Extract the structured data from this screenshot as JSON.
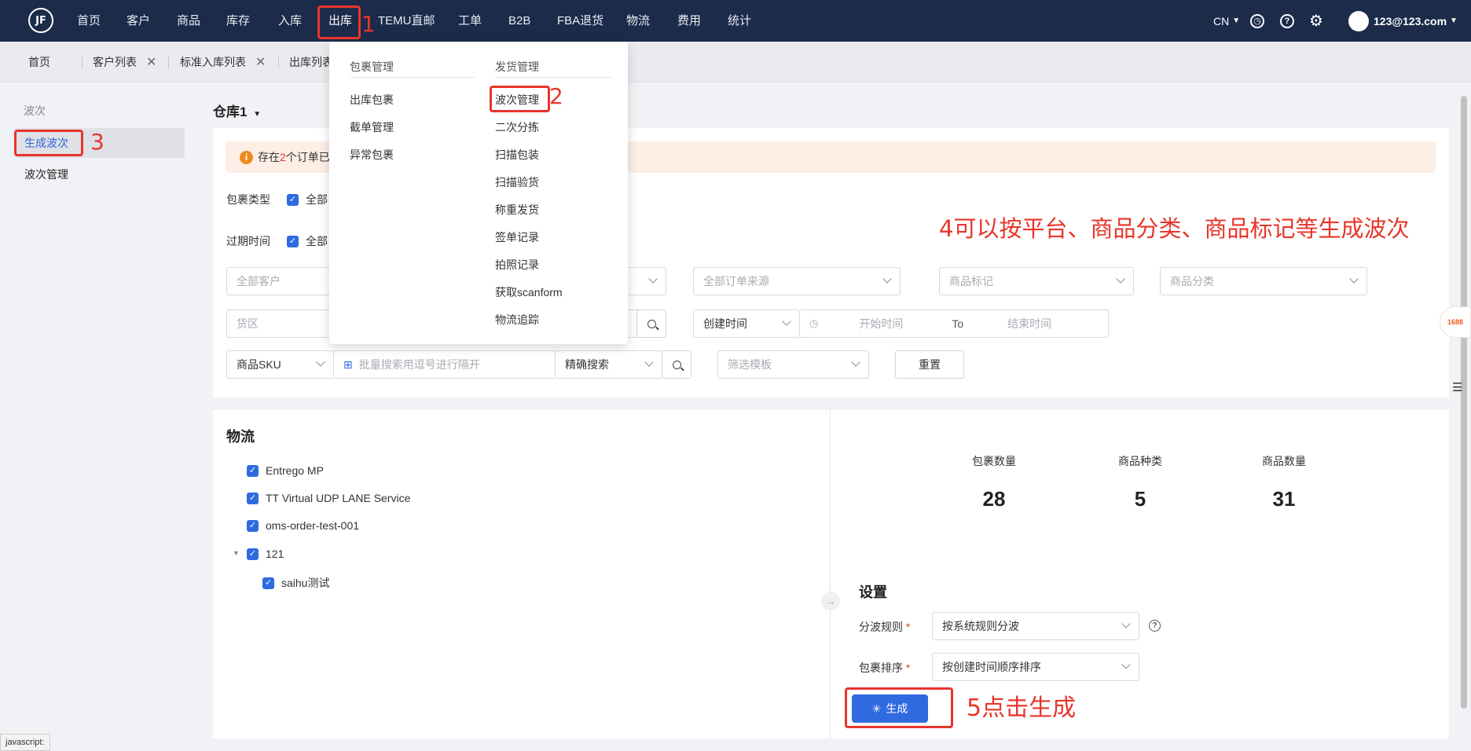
{
  "nav": {
    "logo": "JF",
    "items": [
      "首页",
      "客户",
      "商品",
      "库存",
      "入库",
      "出库",
      "TEMU直邮",
      "工单",
      "B2B",
      "FBA退货",
      "物流",
      "费用",
      "统计"
    ],
    "lang": "CN",
    "user": "123@123.com"
  },
  "tabs": [
    "首页",
    "客户列表",
    "标准入库列表",
    "出库列表"
  ],
  "sidebar": {
    "group": "波次",
    "items": [
      "生成波次",
      "波次管理"
    ]
  },
  "main": {
    "warehouse": "仓库1",
    "alert_pre": "存在",
    "alert_num": "2",
    "alert_post": "个订单已",
    "filters": {
      "package_type_label": "包裹类型",
      "package_type_value": "全部",
      "expire_label": "过期时间",
      "expire_value": "全部",
      "customer_placeholder": "全部客户",
      "order_source_placeholder": "全部订单来源",
      "product_tag_placeholder": "商品标记",
      "product_category_placeholder": "商品分类",
      "area_placeholder": "货区",
      "time_type": "创建时间",
      "start_placeholder": "开始时间",
      "to": "To",
      "end_placeholder": "结束时间",
      "sku_type": "商品SKU",
      "batch_search_placeholder": "批量搜索用逗号进行隔开",
      "search_mode": "精确搜索",
      "template_placeholder": "筛选模板",
      "reset_label": "重置"
    },
    "logistics": {
      "title": "物流",
      "items": [
        "Entrego MP",
        "TT Virtual UDP LANE Service",
        "oms-order-test-001",
        "121",
        "saihu测试"
      ]
    },
    "stats": [
      {
        "label": "包裹数量",
        "value": "28"
      },
      {
        "label": "商品种类",
        "value": "5"
      },
      {
        "label": "商品数量",
        "value": "31"
      }
    ],
    "settings": {
      "title": "设置",
      "rule_label": "分波规则",
      "rule_value": "按系统规则分波",
      "sort_label": "包裹排序",
      "sort_value": "按创建时间顺序排序",
      "generate_label": "生成"
    }
  },
  "menu": {
    "col1_title": "包裹管理",
    "col1_items": [
      "出库包裹",
      "截单管理",
      "异常包裹"
    ],
    "col2_title": "发货管理",
    "col2_items": [
      "波次管理",
      "二次分拣",
      "扫描包装",
      "扫描验货",
      "称重发货",
      "签单记录",
      "拍照记录",
      "获取scanform",
      "物流追踪"
    ]
  },
  "annotations": {
    "a1": "1",
    "a2": "2",
    "a3": "3",
    "a4": "4可以按平台、商品分类、商品标记等生成波次",
    "a5": "5点击生成"
  },
  "status_text": "javascript:",
  "float_badge": "1688",
  "colors": {
    "nav_bg": "#1c2b4a",
    "primary": "#2f6ae0",
    "annotation": "#e8352b"
  }
}
